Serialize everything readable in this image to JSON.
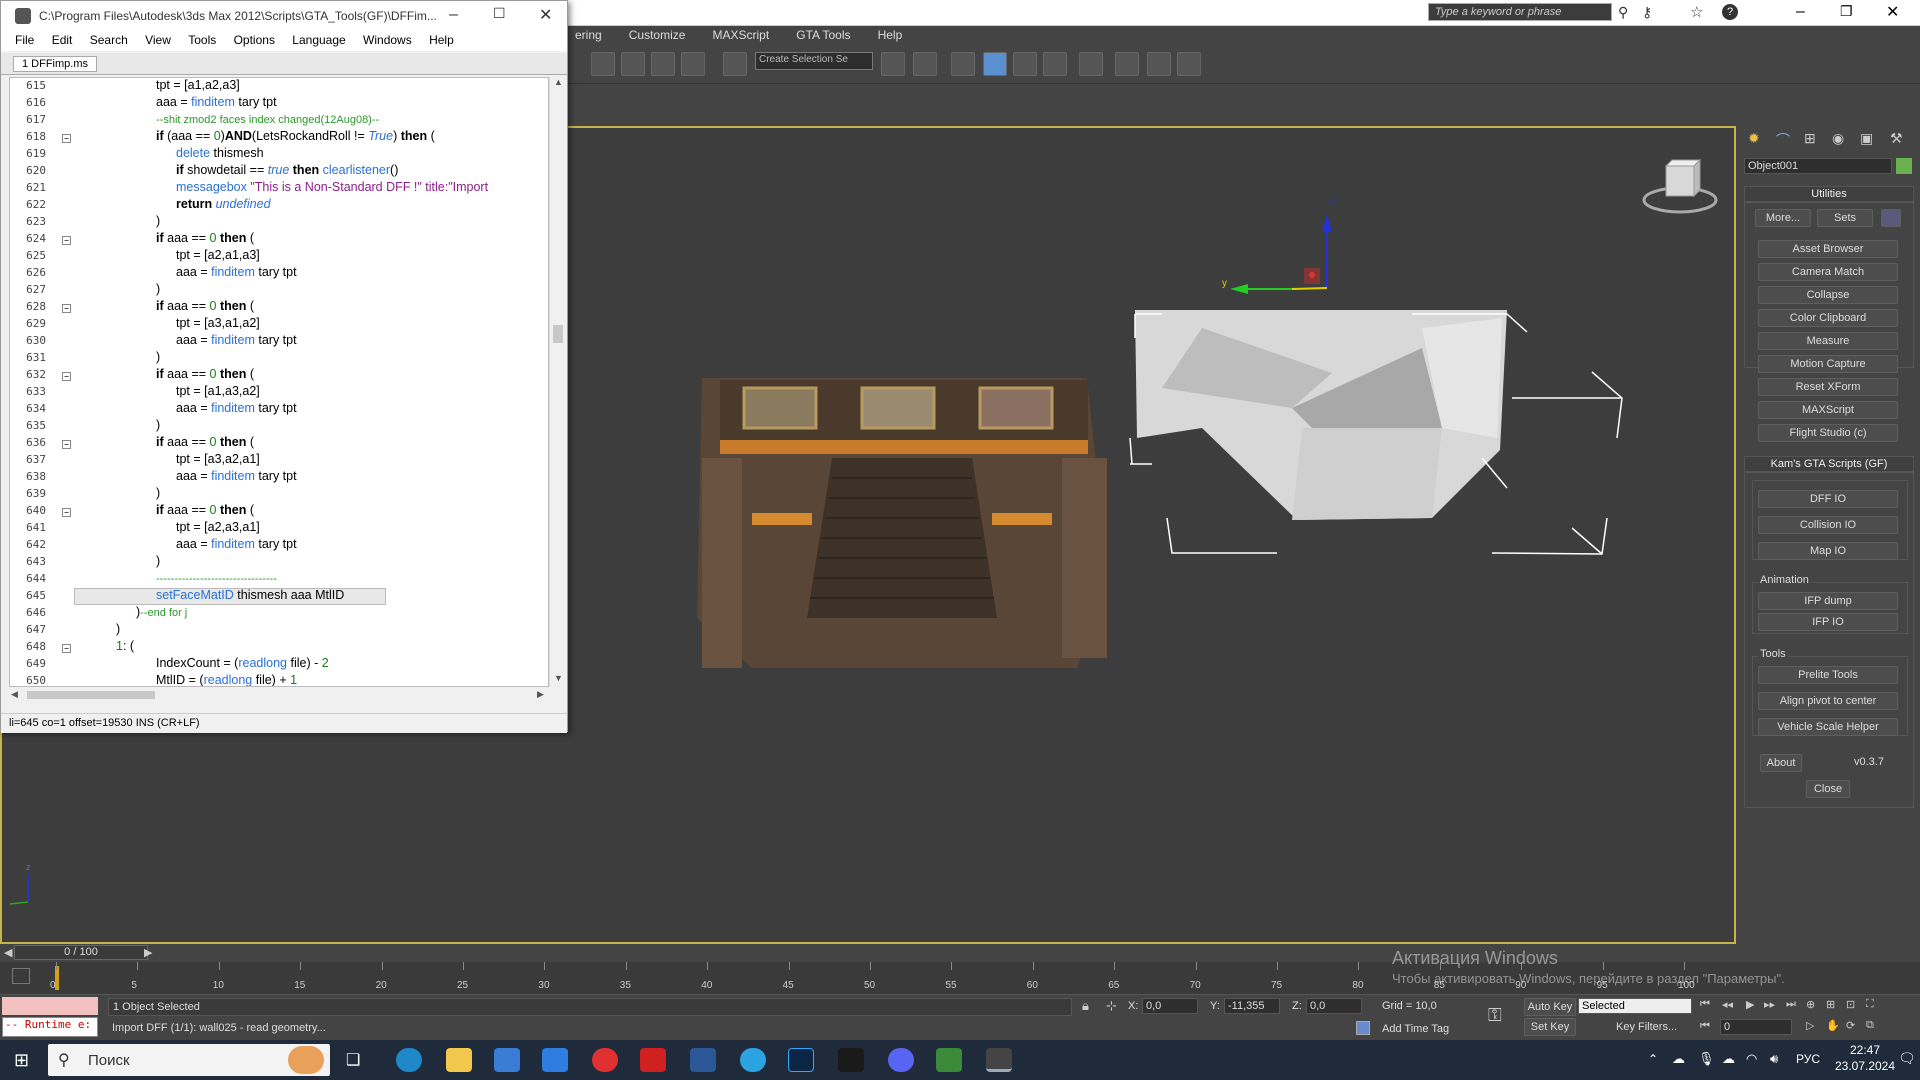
{
  "max": {
    "menu": [
      "ering",
      "Customize",
      "MAXScript",
      "GTA Tools",
      "Help"
    ],
    "search_placeholder": "Type a keyword or phrase",
    "selection_set_placeholder": "Create Selection Se",
    "object_name": "Object001"
  },
  "editor": {
    "title": "C:\\Program Files\\Autodesk\\3ds Max 2012\\Scripts\\GTA_Tools(GF)\\DFFim...",
    "menu": [
      "File",
      "Edit",
      "Search",
      "View",
      "Tools",
      "Options",
      "Language",
      "Windows",
      "Help"
    ],
    "tab": "1 DFFimp.ms",
    "status": "li=645 co=1 offset=19530 INS (CR+LF)",
    "line_numbers": [
      "615",
      "616",
      "617",
      "618",
      "619",
      "620",
      "621",
      "622",
      "623",
      "624",
      "625",
      "626",
      "627",
      "628",
      "629",
      "630",
      "631",
      "632",
      "633",
      "634",
      "635",
      "636",
      "637",
      "638",
      "639",
      "640",
      "641",
      "642",
      "643",
      "644",
      "645",
      "646",
      "647",
      "648",
      "649",
      "650"
    ]
  },
  "utilities": {
    "header": "Utilities",
    "more": "More...",
    "sets": "Sets",
    "buttons": [
      "Asset Browser",
      "Camera Match",
      "Collapse",
      "Color Clipboard",
      "Measure",
      "Motion Capture",
      "Reset XForm",
      "MAXScript",
      "Flight Studio (c)"
    ]
  },
  "gta": {
    "header": "Kam's GTA Scripts (GF)",
    "io_buttons": [
      "DFF IO",
      "Collision IO",
      "Map IO"
    ],
    "animation_label": "Animation",
    "anim_buttons": [
      "IFP dump",
      "IFP IO"
    ],
    "tools_label": "Tools",
    "tool_buttons": [
      "Prelite Tools",
      "Align pivot to center",
      "Vehicle Scale Helper"
    ],
    "about": "About",
    "version": "v0.3.7",
    "close": "Close"
  },
  "timeline": {
    "frame": "0 / 100",
    "ticks": [
      "0",
      "5",
      "10",
      "15",
      "20",
      "25",
      "30",
      "35",
      "40",
      "45",
      "50",
      "55",
      "60",
      "65",
      "70",
      "75",
      "80",
      "85",
      "90",
      "95",
      "100"
    ]
  },
  "status": {
    "selected": "1 Object Selected",
    "prompt": "Import DFF (1/1): wall025 - read geometry...",
    "runtime": "-- Runtime e:",
    "x_label": "X:",
    "x": "0,0",
    "y_label": "Y:",
    "y": "-11,355",
    "z_label": "Z:",
    "z": "0,0",
    "grid": "Grid = 10,0",
    "auto_key": "Auto Key",
    "set_key": "Set Key",
    "key_mode": "Selected",
    "key_filters": "Key Filters...",
    "add_time_tag": "Add Time Tag",
    "frame_field": "0"
  },
  "activation": {
    "line1": "Активация Windows",
    "line2": "Чтобы активировать Windows, перейдите в раздел \"Параметры\"."
  },
  "taskbar": {
    "search": "Поиск",
    "lang": "РУС",
    "time": "22:47",
    "date": "23.07.2024"
  },
  "viewport": {
    "gizmo_y": "y",
    "gizmo_z": "z",
    "mini_z": "z"
  },
  "colors": {
    "viewport_border": "#c8b34a",
    "object_color": "#6ab04c",
    "taskbar": "#1f2b3a"
  }
}
